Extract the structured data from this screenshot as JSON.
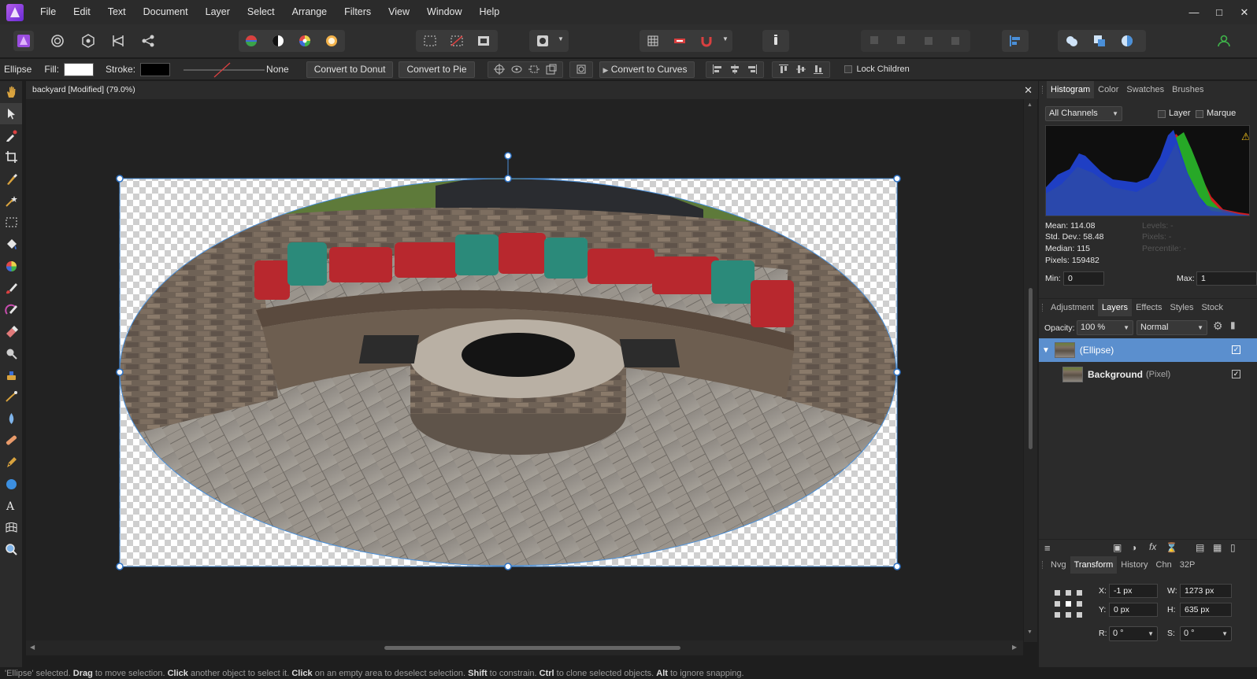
{
  "menubar": {
    "items": [
      "File",
      "Edit",
      "Text",
      "Document",
      "Layer",
      "Select",
      "Arrange",
      "Filters",
      "View",
      "Window",
      "Help"
    ],
    "window_controls": [
      "minimize",
      "maximize",
      "close"
    ]
  },
  "context": {
    "tool_name": "Ellipse",
    "fill_label": "Fill:",
    "fill_color": "#ffffff",
    "stroke_label": "Stroke:",
    "stroke_color": "#000000",
    "stroke_style": "None",
    "convert_donut": "Convert to Donut",
    "convert_pie": "Convert to Pie",
    "convert_curves": "Convert to Curves",
    "lock_children": "Lock Children"
  },
  "document": {
    "tab_title": "backyard [Modified] (79.0%)"
  },
  "panels": {
    "top_tabs": [
      "Histogram",
      "Color",
      "Swatches",
      "Brushes"
    ],
    "top_active": "Histogram",
    "histogram": {
      "channel": "All Channels",
      "layer_label": "Layer",
      "marquee_label": "Marque",
      "mean": "Mean: 114.08",
      "std_dev": "Std. Dev.: 58.48",
      "median": "Median: 115",
      "pixels": "Pixels: 159482",
      "levels": "Levels: -",
      "pixels_dim": "Pixels: -",
      "percentile": "Percentile: -",
      "min_label": "Min:",
      "min_value": "0",
      "max_label": "Max:",
      "max_value": "1"
    },
    "mid_tabs": [
      "Adjustment",
      "Layers",
      "Effects",
      "Styles",
      "Stock"
    ],
    "mid_active": "Layers",
    "layers": {
      "opacity_label": "Opacity:",
      "opacity_value": "100 %",
      "blend_mode": "Normal",
      "items": [
        {
          "name": "",
          "type": "(Ellipse)",
          "selected": true
        },
        {
          "name": "Background",
          "type": "(Pixel)",
          "selected": false
        }
      ]
    },
    "bottom_tabs": [
      "Nvg",
      "Transform",
      "History",
      "Chn",
      "32P"
    ],
    "bottom_active": "Transform",
    "transform": {
      "x_label": "X:",
      "x_value": "-1 px",
      "y_label": "Y:",
      "y_value": "0 px",
      "w_label": "W:",
      "w_value": "1273 px",
      "h_label": "H:",
      "h_value": "635 px",
      "r_label": "R:",
      "r_value": "0 °",
      "s_label": "S:",
      "s_value": "0 °"
    }
  },
  "statusbar": {
    "parts": [
      {
        "text": "'Ellipse' selected. ",
        "bold": false
      },
      {
        "text": "Drag",
        "bold": true
      },
      {
        "text": " to move selection. ",
        "bold": false
      },
      {
        "text": "Click",
        "bold": true
      },
      {
        "text": " another object to select it. ",
        "bold": false
      },
      {
        "text": "Click",
        "bold": true
      },
      {
        "text": " on an empty area to deselect selection. ",
        "bold": false
      },
      {
        "text": "Shift",
        "bold": true
      },
      {
        "text": " to constrain. ",
        "bold": false
      },
      {
        "text": "Ctrl",
        "bold": true
      },
      {
        "text": " to clone selected objects. ",
        "bold": false
      },
      {
        "text": "Alt",
        "bold": true
      },
      {
        "text": " to ignore snapping.",
        "bold": false
      }
    ]
  },
  "colors": {
    "accent": "#4a8fd8",
    "selection_row": "#5b8fce",
    "panel_bg": "#2b2b2b"
  }
}
